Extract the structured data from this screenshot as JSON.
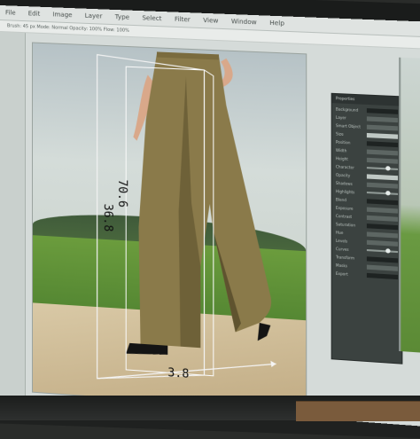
{
  "menubar": {
    "items": [
      "File",
      "Edit",
      "Image",
      "Layer",
      "Type",
      "Select",
      "Filter",
      "View",
      "Window",
      "Help"
    ]
  },
  "optbar": {
    "text": "Brush: 45 px  Mode: Normal  Opacity: 100%  Flow: 100%"
  },
  "dimensions": {
    "height_label": "70.6",
    "side_label": "36.8",
    "width_label": "3.8"
  },
  "panel": {
    "title": "Properties",
    "rows": [
      {
        "label": "Background",
        "kind": "dark"
      },
      {
        "label": "Layer",
        "kind": "field"
      },
      {
        "label": "Smart Object",
        "kind": "field"
      },
      {
        "label": "Size",
        "kind": "light"
      },
      {
        "label": "Position",
        "kind": "dark"
      },
      {
        "label": "Width",
        "kind": "field"
      },
      {
        "label": "Height",
        "kind": "field"
      },
      {
        "label": "Character",
        "kind": "slider"
      },
      {
        "label": "Opacity",
        "kind": "light"
      },
      {
        "label": "Shadows",
        "kind": "field"
      },
      {
        "label": "Highlights",
        "kind": "slider"
      },
      {
        "label": "Blend",
        "kind": "dark"
      },
      {
        "label": "Exposure",
        "kind": "field"
      },
      {
        "label": "Contrast",
        "kind": "field"
      },
      {
        "label": "Saturation",
        "kind": "dark"
      },
      {
        "label": "Hue",
        "kind": "field"
      },
      {
        "label": "Levels",
        "kind": "field"
      },
      {
        "label": "Curves",
        "kind": "slider"
      },
      {
        "label": "Transform",
        "kind": "dark"
      },
      {
        "label": "Masks",
        "kind": "field"
      },
      {
        "label": "Export",
        "kind": "dark"
      }
    ]
  },
  "colors": {
    "trousers": "#8a7a4a",
    "trousers_shadow": "#5f532f",
    "grass": "#5a8f35",
    "panel": "#3b4240"
  },
  "taskbar_colors": [
    "#3c7bd6",
    "#e0a030",
    "#5bbf5b",
    "#d94b4b",
    "#9a6bd9",
    "#4fb3c9",
    "#2f2f2f",
    "#7ac943",
    "#ffffff",
    "#2a2a2a",
    "#53b14f",
    "#e5e5e5"
  ]
}
